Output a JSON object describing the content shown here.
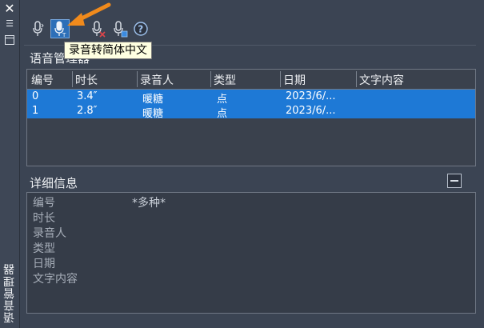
{
  "panel": {
    "title": "语音管理器",
    "close_icon": "close-icon",
    "menu_icon": "menu-icon",
    "window_icon": "window-icon"
  },
  "toolbar": {
    "buttons": [
      {
        "icon": "microphone-icon",
        "name": "record"
      },
      {
        "icon": "microphone-text-icon",
        "name": "record-to-chinese",
        "selected": true
      },
      {
        "icon": "microphone-delete-icon",
        "name": "delete"
      },
      {
        "icon": "microphone-export-icon",
        "name": "export"
      },
      {
        "icon": "help-icon",
        "name": "help"
      }
    ],
    "tooltip": "录音转简体中文"
  },
  "manager": {
    "title": "语音管理器",
    "columns": [
      "编号",
      "时长",
      "录音人",
      "类型",
      "日期",
      "文字内容"
    ],
    "rows": [
      {
        "id": "0",
        "duration": "3.4″",
        "recorder": "暖糖",
        "type": "点",
        "date": "2023/6/...",
        "text": ""
      },
      {
        "id": "1",
        "duration": "2.8″",
        "recorder": "暖糖",
        "type": "点",
        "date": "2023/6/...",
        "text": ""
      }
    ]
  },
  "details": {
    "title": "详细信息",
    "fields": [
      "编号",
      "时长",
      "录音人",
      "类型",
      "日期",
      "文字内容"
    ],
    "value": "*多种*"
  },
  "colors": {
    "background": "#3b4453",
    "selection": "#1e79d6",
    "arrow": "#f08a1c",
    "tooltip_bg": "#ffffe1"
  }
}
